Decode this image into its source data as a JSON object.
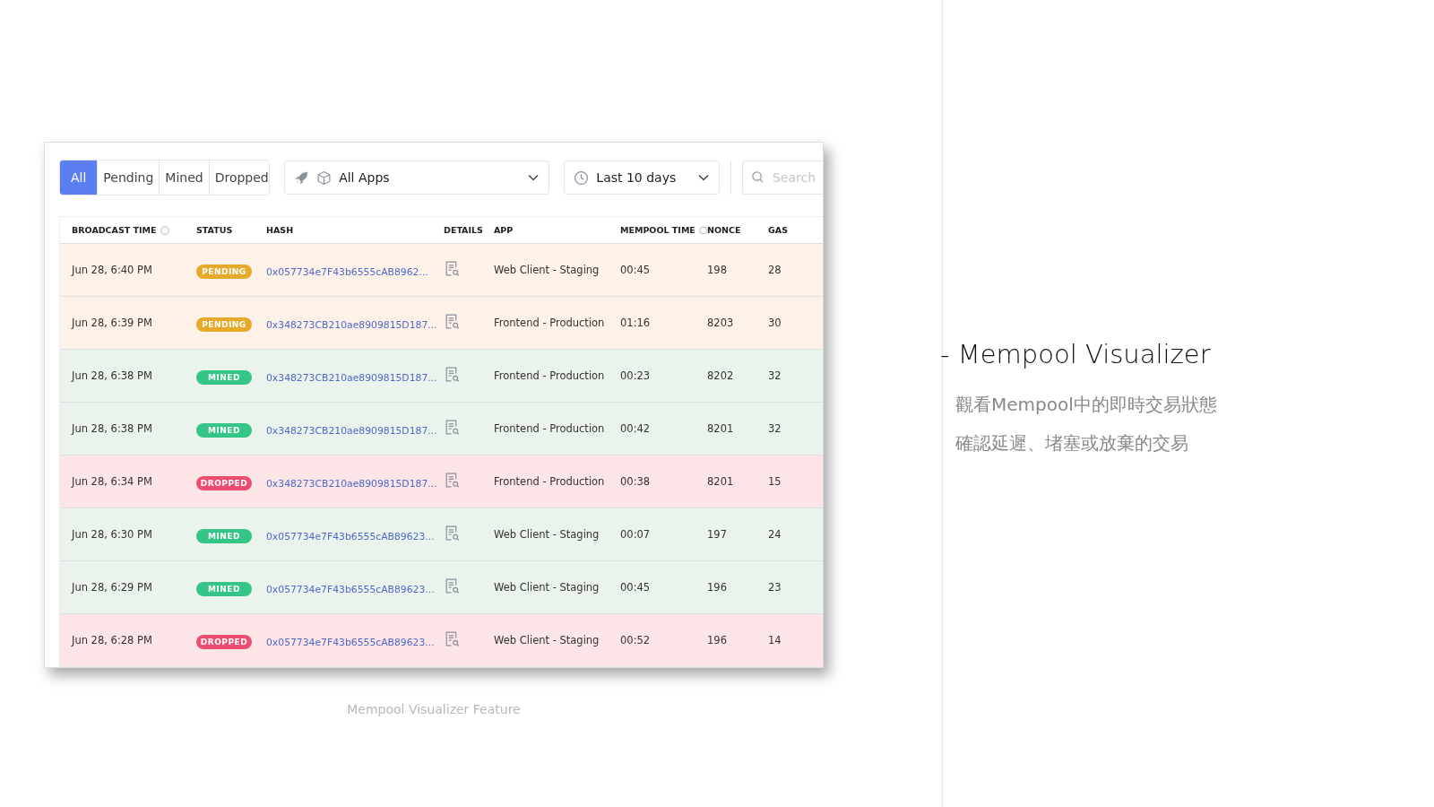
{
  "filters": [
    {
      "label": "All",
      "selected": true
    },
    {
      "label": "Pending",
      "selected": false
    },
    {
      "label": "Mined",
      "selected": false
    },
    {
      "label": "Dropped",
      "selected": false
    }
  ],
  "app_select": {
    "value": "All Apps"
  },
  "time_select": {
    "value": "Last 10 days"
  },
  "search": {
    "placeholder": "Search"
  },
  "table": {
    "columns": [
      {
        "label": "BROADCAST TIME",
        "info_icon": true
      },
      {
        "label": "STATUS",
        "info_icon": false
      },
      {
        "label": "HASH",
        "info_icon": false
      },
      {
        "label": "DETAILS",
        "info_icon": false
      },
      {
        "label": "APP",
        "info_icon": false
      },
      {
        "label": "MEMPOOL TIME",
        "info_icon": true
      },
      {
        "label": "NONCE",
        "info_icon": false
      },
      {
        "label": "GAS",
        "info_icon": false
      }
    ],
    "rows": [
      {
        "time": "Jun 28, 6:40 PM",
        "status": {
          "kind": "pending",
          "label": "PENDING"
        },
        "hash": "0x057734e7F43b6555cAB8962...",
        "app": "Web Client - Staging",
        "mempool_time": "00:45",
        "nonce": "198",
        "gas": "28"
      },
      {
        "time": "Jun 28, 6:39 PM",
        "status": {
          "kind": "pending",
          "label": "PENDING"
        },
        "hash": "0x348273CB210ae8909815D187...",
        "app": "Frontend - Production",
        "mempool_time": "01:16",
        "nonce": "8203",
        "gas": "30"
      },
      {
        "time": "Jun 28, 6:38 PM",
        "status": {
          "kind": "mined",
          "label": "MINED"
        },
        "hash": "0x348273CB210ae8909815D187...",
        "app": "Frontend - Production",
        "mempool_time": "00:23",
        "nonce": "8202",
        "gas": "32"
      },
      {
        "time": "Jun 28, 6:38 PM",
        "status": {
          "kind": "mined",
          "label": "MINED"
        },
        "hash": "0x348273CB210ae8909815D187...",
        "app": "Frontend - Production",
        "mempool_time": "00:42",
        "nonce": "8201",
        "gas": "32"
      },
      {
        "time": "Jun 28, 6:34 PM",
        "status": {
          "kind": "dropped",
          "label": "DROPPED"
        },
        "hash": "0x348273CB210ae8909815D187...",
        "app": "Frontend - Production",
        "mempool_time": "00:38",
        "nonce": "8201",
        "gas": "15"
      },
      {
        "time": "Jun 28, 6:30 PM",
        "status": {
          "kind": "mined",
          "label": "MINED"
        },
        "hash": "0x057734e7F43b6555cAB89623...",
        "app": "Web Client - Staging",
        "mempool_time": "00:07",
        "nonce": "197",
        "gas": "24"
      },
      {
        "time": "Jun 28, 6:29 PM",
        "status": {
          "kind": "mined",
          "label": "MINED"
        },
        "hash": "0x057734e7F43b6555cAB89623...",
        "app": "Web Client - Staging",
        "mempool_time": "00:45",
        "nonce": "196",
        "gas": "23"
      },
      {
        "time": "Jun 28, 6:28 PM",
        "status": {
          "kind": "dropped",
          "label": "DROPPED"
        },
        "hash": "0x057734e7F43b6555cAB89623...",
        "app": "Web Client - Staging",
        "mempool_time": "00:52",
        "nonce": "196",
        "gas": "14"
      }
    ]
  },
  "caption": "Mempool Visualizer Feature",
  "slide": {
    "heading": "- Mempool Visualizer",
    "lines": [
      "觀看Mempool中的即時交易狀態",
      "確認延遲、堵塞或放棄的交易"
    ]
  }
}
